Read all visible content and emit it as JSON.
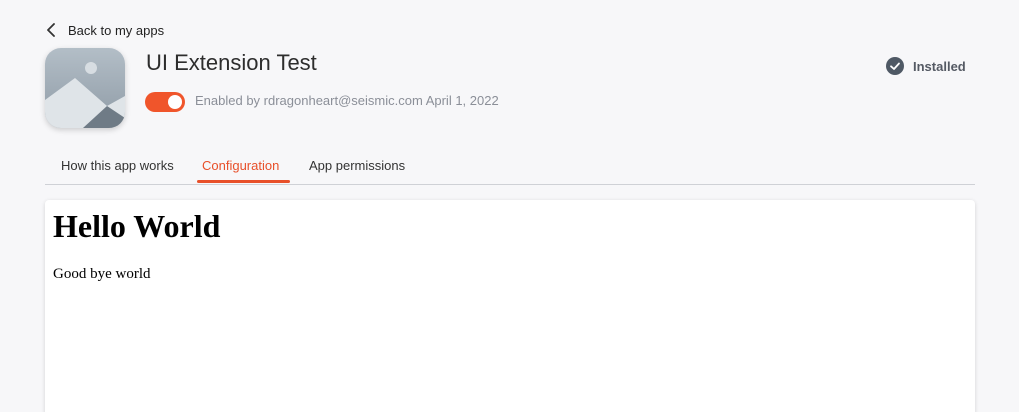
{
  "header": {
    "back_label": "Back to my apps",
    "back_icon": "chevron-left-icon",
    "app_icon": "image-placeholder-icon",
    "app_title": "UI Extension Test",
    "enabled_toggle": {
      "on": true,
      "color": "#f0552b"
    },
    "enabled_text": "Enabled by rdragonheart@seismic.com April 1, 2022",
    "status": {
      "icon": "check-circle-icon",
      "label": "Installed"
    }
  },
  "tabs": [
    {
      "label": "How this app works",
      "active": false
    },
    {
      "label": "Configuration",
      "active": true
    },
    {
      "label": "App permissions",
      "active": false
    }
  ],
  "content": {
    "heading": "Hello World",
    "text": "Good bye world"
  },
  "colors": {
    "accent": "#e8502a",
    "background": "#f7f7f9"
  }
}
